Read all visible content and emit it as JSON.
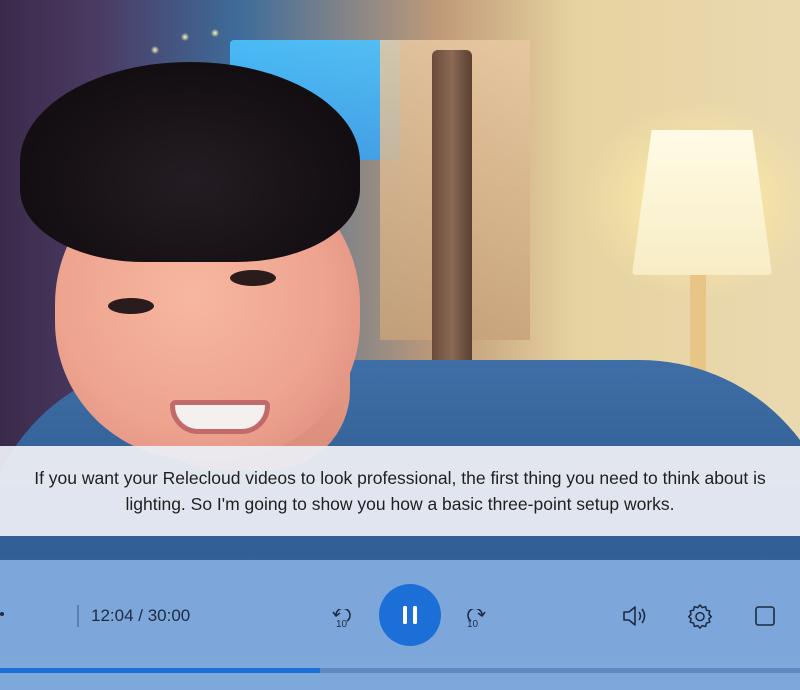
{
  "caption": {
    "text": "If you want your Relecloud videos to look professional, the first thing you need to think about is lighting. So I'm going to show you how a basic three-point setup works."
  },
  "player": {
    "time_display": "12:04 / 30:00",
    "rewind_label": "10",
    "forward_label": "10",
    "progress_fraction": 0.4,
    "accent_color": "#1d6fd8",
    "icons": {
      "rewind": "rewind-10-icon",
      "play_pause": "pause-icon",
      "forward": "forward-10-icon",
      "volume": "volume-icon",
      "settings": "gear-icon",
      "fullscreen": "fullscreen-icon"
    }
  }
}
